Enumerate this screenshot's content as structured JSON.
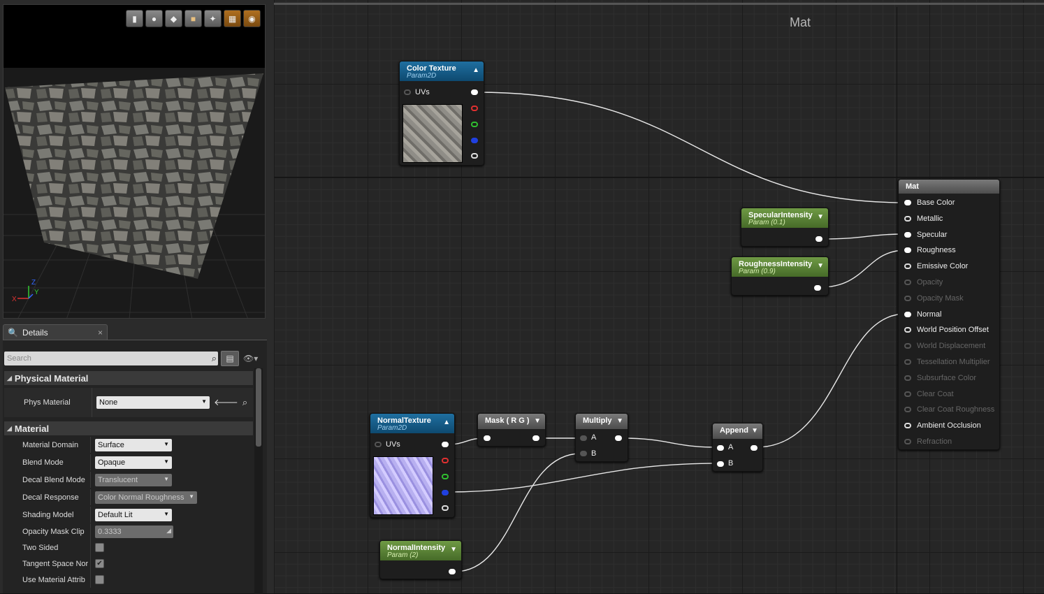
{
  "viewport": {
    "toolbar_icons": [
      "cylinder-icon",
      "sphere-icon",
      "plane-icon",
      "cube-icon",
      "custom-mesh-icon",
      "grid-icon",
      "realtime-icon"
    ],
    "axis_labels": {
      "x": "X",
      "y": "Y",
      "z": "Z"
    }
  },
  "details": {
    "tab_label": "Details",
    "search_placeholder": "Search",
    "sections": {
      "physical": {
        "title": "Physical Material",
        "phys_label": "Phys Material",
        "phys_value": "None"
      },
      "material": {
        "title": "Material",
        "rows": [
          {
            "label": "Material Domain",
            "value": "Surface"
          },
          {
            "label": "Blend Mode",
            "value": "Opaque"
          },
          {
            "label": "Decal Blend Mode",
            "value": "Translucent"
          },
          {
            "label": "Decal Response",
            "value": "Color Normal Roughness"
          },
          {
            "label": "Shading Model",
            "value": "Default Lit"
          },
          {
            "label": "Opacity Mask Clip",
            "value": "0.3333"
          },
          {
            "label": "Two Sided",
            "checked": false
          },
          {
            "label": "Tangent Space Nor",
            "checked": true
          },
          {
            "label": "Use Material Attrib",
            "checked": false
          }
        ]
      }
    }
  },
  "graph": {
    "title": "Mat",
    "nodes": {
      "color_texture": {
        "title": "Color Texture",
        "sub": "Param2D",
        "input": "UVs"
      },
      "normal_texture": {
        "title": "NormalTexture",
        "sub": "Param2D",
        "input": "UVs"
      },
      "specular": {
        "title": "SpecularIntensity",
        "sub": "Param (0.1)"
      },
      "roughness": {
        "title": "RoughnessIntensity",
        "sub": "Param (0.9)"
      },
      "normal_intensity": {
        "title": "NormalIntensity",
        "sub": "Param (2)"
      },
      "mask": {
        "title": "Mask ( R G )"
      },
      "multiply": {
        "title": "Multiply",
        "a": "A",
        "b": "B"
      },
      "append": {
        "title": "Append",
        "a": "A",
        "b": "B"
      },
      "mat": {
        "title": "Mat",
        "inputs": [
          {
            "label": "Base Color",
            "active": true
          },
          {
            "label": "Metallic",
            "active": true
          },
          {
            "label": "Specular",
            "active": true
          },
          {
            "label": "Roughness",
            "active": true
          },
          {
            "label": "Emissive Color",
            "active": true
          },
          {
            "label": "Opacity",
            "active": false
          },
          {
            "label": "Opacity Mask",
            "active": false
          },
          {
            "label": "Normal",
            "active": true
          },
          {
            "label": "World Position Offset",
            "active": true
          },
          {
            "label": "World Displacement",
            "active": false
          },
          {
            "label": "Tessellation Multiplier",
            "active": false
          },
          {
            "label": "Subsurface Color",
            "active": false
          },
          {
            "label": "Clear Coat",
            "active": false
          },
          {
            "label": "Clear Coat Roughness",
            "active": false
          },
          {
            "label": "Ambient Occlusion",
            "active": true
          },
          {
            "label": "Refraction",
            "active": false
          }
        ]
      }
    }
  }
}
